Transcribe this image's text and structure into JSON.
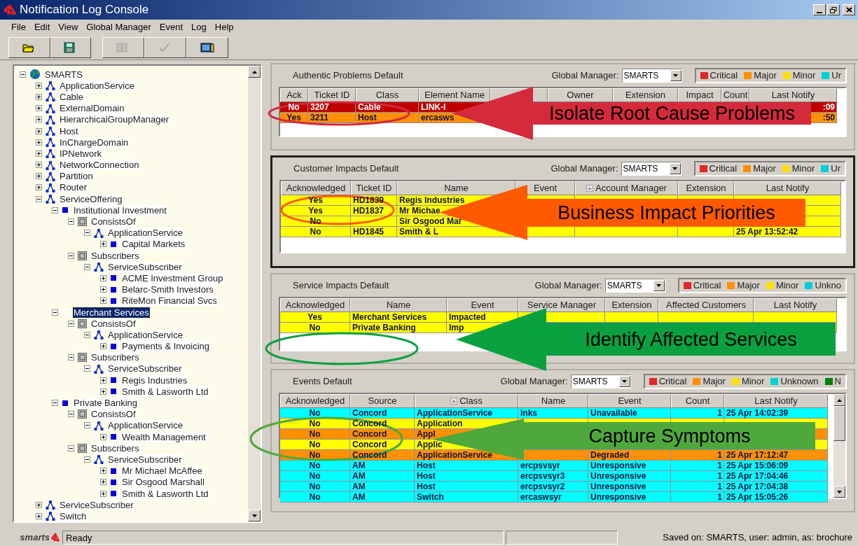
{
  "window": {
    "title": "Notification Log Console"
  },
  "menu": [
    "File",
    "Edit",
    "View",
    "Global Manager",
    "Event",
    "Log",
    "Help"
  ],
  "toolbar": [
    {
      "disabled": false
    },
    {
      "disabled": false
    },
    {
      "disabled": true
    },
    {
      "disabled": true
    },
    {
      "disabled": false
    }
  ],
  "tree": {
    "label": "SMARTS",
    "kind": "domain",
    "expanded": true,
    "selected": false,
    "children": [
      {
        "label": "ApplicationService",
        "kind": "class",
        "expanded": false,
        "selected": false
      },
      {
        "label": "Cable",
        "kind": "class",
        "expanded": false,
        "selected": false
      },
      {
        "label": "ExternalDomain",
        "kind": "class",
        "expanded": false,
        "selected": false
      },
      {
        "label": "HierarchicalGroupManager",
        "kind": "class",
        "expanded": false,
        "selected": false
      },
      {
        "label": "Host",
        "kind": "class",
        "expanded": false,
        "selected": false
      },
      {
        "label": "InChargeDomain",
        "kind": "class",
        "expanded": false,
        "selected": false
      },
      {
        "label": "IPNetwork",
        "kind": "class",
        "expanded": false,
        "selected": false
      },
      {
        "label": "NetworkConnection",
        "kind": "class",
        "expanded": false,
        "selected": false
      },
      {
        "label": "Partition",
        "kind": "class",
        "expanded": false,
        "selected": false
      },
      {
        "label": "Router",
        "kind": "class",
        "expanded": false,
        "selected": false
      },
      {
        "label": "ServiceOffering",
        "kind": "class",
        "expanded": true,
        "selected": false,
        "children": [
          {
            "label": "Institutional Investment",
            "kind": "instance",
            "expanded": true,
            "selected": false,
            "children": [
              {
                "label": "ConsistsOf",
                "kind": "relationship",
                "expanded": true,
                "selected": false,
                "children": [
                  {
                    "label": "ApplicationService",
                    "kind": "class",
                    "expanded": true,
                    "selected": false,
                    "children": [
                      {
                        "label": "Capital Markets",
                        "kind": "instance",
                        "expanded": false,
                        "selected": false
                      }
                    ]
                  }
                ]
              },
              {
                "label": "Subscribers",
                "kind": "relationship",
                "expanded": true,
                "selected": false,
                "children": [
                  {
                    "label": "ServiceSubscriber",
                    "kind": "class",
                    "expanded": true,
                    "selected": false,
                    "children": [
                      {
                        "label": "ACME Investment Group",
                        "kind": "instance",
                        "expanded": false,
                        "selected": false
                      },
                      {
                        "label": "Belarc-Smith Investors",
                        "kind": "instance",
                        "expanded": false,
                        "selected": false
                      },
                      {
                        "label": "RiteMon Financial Svcs",
                        "kind": "instance",
                        "expanded": false,
                        "selected": false
                      }
                    ]
                  }
                ]
              }
            ]
          },
          {
            "label": "Merchant Services",
            "kind": "instance",
            "expanded": true,
            "selected": true,
            "children": [
              {
                "label": "ConsistsOf",
                "kind": "relationship",
                "expanded": true,
                "selected": false,
                "children": [
                  {
                    "label": "ApplicationService",
                    "kind": "class",
                    "expanded": true,
                    "selected": false,
                    "children": [
                      {
                        "label": "Payments & Invoicing",
                        "kind": "instance",
                        "expanded": false,
                        "selected": false
                      }
                    ]
                  }
                ]
              },
              {
                "label": "Subscribers",
                "kind": "relationship",
                "expanded": true,
                "selected": false,
                "children": [
                  {
                    "label": "ServiceSubscriber",
                    "kind": "class",
                    "expanded": true,
                    "selected": false,
                    "children": [
                      {
                        "label": "Regis Industries",
                        "kind": "instance",
                        "expanded": false,
                        "selected": false
                      },
                      {
                        "label": "Smith & Lasworth Ltd",
                        "kind": "instance",
                        "expanded": false,
                        "selected": false
                      }
                    ]
                  }
                ]
              }
            ]
          },
          {
            "label": "Private Banking",
            "kind": "instance",
            "expanded": true,
            "selected": false,
            "children": [
              {
                "label": "ConsistsOf",
                "kind": "relationship",
                "expanded": true,
                "selected": false,
                "children": [
                  {
                    "label": "ApplicationService",
                    "kind": "class",
                    "expanded": true,
                    "selected": false,
                    "children": [
                      {
                        "label": "Wealth Management",
                        "kind": "instance",
                        "expanded": false,
                        "selected": false
                      }
                    ]
                  }
                ]
              },
              {
                "label": "Subscribers",
                "kind": "relationship",
                "expanded": true,
                "selected": false,
                "children": [
                  {
                    "label": "ServiceSubscriber",
                    "kind": "class",
                    "expanded": true,
                    "selected": false,
                    "children": [
                      {
                        "label": "Mr Michael McAffee",
                        "kind": "instance",
                        "expanded": false,
                        "selected": false
                      },
                      {
                        "label": "Sir Osgood Marshall",
                        "kind": "instance",
                        "expanded": false,
                        "selected": false
                      },
                      {
                        "label": "Smith & Lasworth Ltd",
                        "kind": "instance",
                        "expanded": false,
                        "selected": false
                      }
                    ]
                  }
                ]
              }
            ]
          }
        ]
      },
      {
        "label": "ServiceSubscriber",
        "kind": "class",
        "expanded": false,
        "selected": false
      },
      {
        "label": "Switch",
        "kind": "class",
        "expanded": false,
        "selected": false
      }
    ]
  },
  "panels": [
    {
      "title": "Authentic Problems Default",
      "focused": false,
      "gm_label": "Global Manager:",
      "gm_value": "SMARTS",
      "legend": [
        {
          "label": "Critical",
          "color": "#e02828"
        },
        {
          "label": "Major",
          "color": "#ff9000"
        },
        {
          "label": "Minor",
          "color": "#ffe000"
        },
        {
          "label": "Ur",
          "color": "#00d0d8"
        }
      ],
      "columns": [
        {
          "label": "Ack",
          "sorted": false
        },
        {
          "label": "Ticket ID",
          "sorted": false
        },
        {
          "label": "Class",
          "sorted": false
        },
        {
          "label": "Element Name",
          "sorted": false
        },
        {},
        {
          "label": "Owner",
          "sorted": false
        },
        {
          "label": "Extension",
          "sorted": false
        },
        {
          "label": "Impact",
          "sorted": false
        },
        {
          "label": "Count",
          "sorted": false
        },
        {
          "label": "Last Notify",
          "sorted": false
        }
      ],
      "rows": [
        {
          "color": "#c00000",
          "cells": [
            "No",
            "3207",
            "Cable",
            "LINK-I",
            null,
            null,
            null,
            null,
            null,
            ":09"
          ]
        },
        {
          "color": "#ff9000",
          "cells": [
            "Yes",
            "3211",
            "Host",
            "ercasws",
            null,
            null,
            null,
            null,
            null,
            ":50"
          ]
        }
      ]
    },
    {
      "title": "Customer Impacts Default",
      "focused": true,
      "gm_label": "Global Manager:",
      "gm_value": "SMARTS",
      "legend": [
        {
          "label": "Critical",
          "color": "#e02828"
        },
        {
          "label": "Major",
          "color": "#ff9000"
        },
        {
          "label": "Minor",
          "color": "#ffe000"
        },
        {
          "label": "Ur",
          "color": "#00d0d8"
        }
      ],
      "columns": [
        {
          "label": "Acknowledged",
          "sorted": false
        },
        {
          "label": "Ticket ID",
          "sorted": false
        },
        {
          "label": "Name",
          "sorted": false
        },
        {
          "label": "Event",
          "sorted": false
        },
        {
          "label": "Account Manager",
          "sorted": true
        },
        {
          "label": "Extension",
          "sorted": false
        },
        {
          "label": "Last Notify",
          "sorted": false
        }
      ],
      "rows": [
        {
          "color": "#ffff00",
          "cells": [
            "Yes",
            "HD1839",
            "Regis Industries",
            null,
            null,
            null,
            null
          ]
        },
        {
          "color": "#ffff00",
          "cells": [
            "Yes",
            "HD1837",
            "Mr Michae",
            null,
            null,
            null,
            null
          ]
        },
        {
          "color": "#ffff00",
          "cells": [
            "No",
            null,
            "Sir Osgood Mar",
            null,
            null,
            null,
            null
          ]
        },
        {
          "color": "#ffff00",
          "cells": [
            "No",
            "HD1845",
            "Smith & L",
            null,
            null,
            null,
            "25 Apr 13:52:42"
          ]
        }
      ]
    },
    {
      "title": "Service Impacts Default",
      "focused": false,
      "gm_label": "Global Manager:",
      "gm_value": "SMARTS",
      "legend": [
        {
          "label": "Critical",
          "color": "#e02828"
        },
        {
          "label": "Major",
          "color": "#ff9000"
        },
        {
          "label": "Minor",
          "color": "#ffe000"
        },
        {
          "label": "Unkno",
          "color": "#00d0d8"
        }
      ],
      "columns": [
        {
          "label": "Acknowledged",
          "sorted": false
        },
        {
          "label": "Name",
          "sorted": false
        },
        {
          "label": "Event",
          "sorted": false
        },
        {
          "label": "Service Manager",
          "sorted": false
        },
        {
          "label": "Extension",
          "sorted": false
        },
        {
          "label": "Affected Customers",
          "sorted": false
        },
        {
          "label": "Last Notify",
          "sorted": false
        }
      ],
      "rows": [
        {
          "color": "#ffff00",
          "cells": [
            "Yes",
            "Merchant Services",
            "Impacted",
            null,
            null,
            null,
            null
          ]
        },
        {
          "color": "#ffff00",
          "cells": [
            "No",
            "Private Banking",
            "Imp",
            null,
            null,
            null,
            null
          ]
        }
      ]
    },
    {
      "title": "Events Default",
      "focused": false,
      "gm_label": "Global Manager:",
      "gm_value": "SMARTS",
      "legend": [
        {
          "label": "Critical",
          "color": "#e02828"
        },
        {
          "label": "Major",
          "color": "#ff9000"
        },
        {
          "label": "Minor",
          "color": "#ffe000"
        },
        {
          "label": "Unknown",
          "color": "#00d0d8"
        },
        {
          "label": "N",
          "color": "#008000"
        }
      ],
      "columns": [
        {
          "label": "Acknowledged",
          "sorted": false
        },
        {
          "label": "Source",
          "sorted": false
        },
        {
          "label": "Class",
          "sorted": true
        },
        {
          "label": "Name",
          "sorted": false
        },
        {
          "label": "Event",
          "sorted": false
        },
        {
          "label": "Count",
          "sorted": false
        },
        {
          "label": "Last Notify",
          "sorted": false
        }
      ],
      "rows": [
        {
          "color": "#00ffff",
          "cells": [
            "No",
            "Concord",
            "ApplicationService",
            "inks",
            "Unavailable",
            "1",
            "25 Apr 14:02:39"
          ]
        },
        {
          "color": "#ffff00",
          "cells": [
            "No",
            "Concord",
            "Application",
            null,
            null,
            null,
            null
          ]
        },
        {
          "color": "#ff9000",
          "cells": [
            "No",
            "Concord",
            "Appl",
            null,
            null,
            null,
            null
          ]
        },
        {
          "color": "#ffff00",
          "cells": [
            "No",
            "Concord",
            "Applic",
            null,
            null,
            null,
            null
          ]
        },
        {
          "color": "#ff9000",
          "cells": [
            "No",
            "Concord",
            "ApplicationService",
            null,
            "Degraded",
            "1",
            "25 Apr 17:12:47"
          ]
        },
        {
          "color": "#00ffff",
          "cells": [
            "No",
            "AM",
            "Host",
            "ercpsvsyr",
            "Unresponsive",
            "1",
            "25 Apr 15:06:09"
          ]
        },
        {
          "color": "#00ffff",
          "cells": [
            "No",
            "AM",
            "Host",
            "ercpsvsyr3",
            "Unresponsive",
            "1",
            "25 Apr 17:04:46"
          ]
        },
        {
          "color": "#00ffff",
          "cells": [
            "No",
            "AM",
            "Host",
            "ercpsvsyr2",
            "Unresponsive",
            "1",
            "25 Apr 17:04:38"
          ]
        },
        {
          "color": "#00ffff",
          "cells": [
            "No",
            "AM",
            "Switch",
            "ercaswsyr",
            "Unresponsive",
            "1",
            "25 Apr 15:05:26"
          ]
        }
      ]
    }
  ],
  "callouts": [
    {
      "text": "Isolate Root Cause Problems",
      "color": "#d42a3c"
    },
    {
      "text": "Business Impact Priorities",
      "color": "#ff5a00"
    },
    {
      "text": "Identify Affected Services",
      "color": "#0aa040"
    },
    {
      "text": "Capture Symptoms",
      "color": "#4fa83c"
    }
  ],
  "status_bar": {
    "logo": "smarts",
    "message": "Ready",
    "saved": "Saved on: SMARTS, user: admin, as: brochure"
  }
}
